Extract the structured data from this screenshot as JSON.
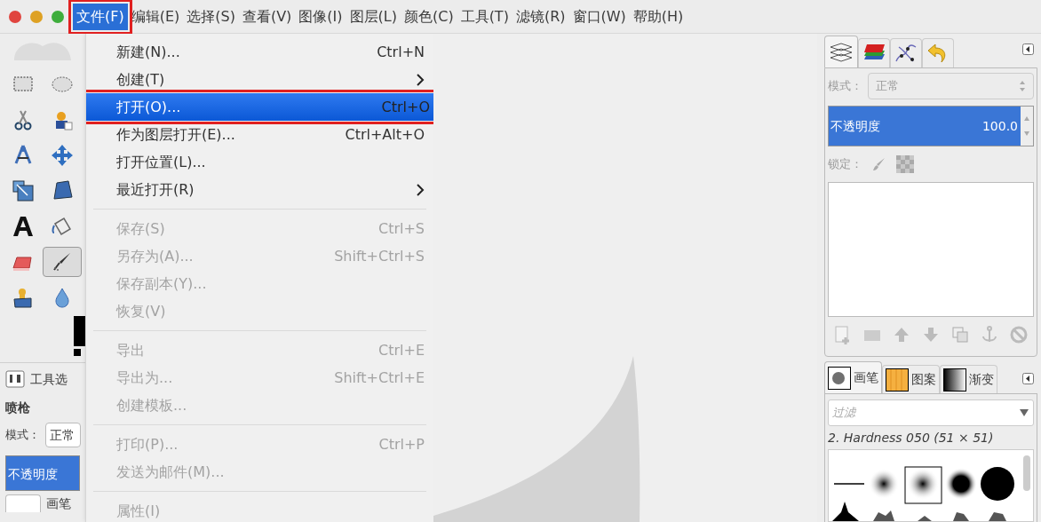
{
  "window_controls": [
    {
      "color": "#e0443e"
    },
    {
      "color": "#dea123"
    },
    {
      "color": "#3ead3c"
    }
  ],
  "menubar": [
    {
      "label": "文件(F)",
      "selected": true,
      "annotated": true
    },
    {
      "label": "编辑(E)",
      "selected": false,
      "annotated": false
    },
    {
      "label": "选择(S)",
      "selected": false,
      "annotated": false
    },
    {
      "label": "查看(V)",
      "selected": false,
      "annotated": false
    },
    {
      "label": "图像(I)",
      "selected": false,
      "annotated": false
    },
    {
      "label": "图层(L)",
      "selected": false,
      "annotated": false
    },
    {
      "label": "颜色(C)",
      "selected": false,
      "annotated": false
    },
    {
      "label": "工具(T)",
      "selected": false,
      "annotated": false
    },
    {
      "label": "滤镜(R)",
      "selected": false,
      "annotated": false
    },
    {
      "label": "窗口(W)",
      "selected": false,
      "annotated": false
    },
    {
      "label": "帮助(H)",
      "selected": false,
      "annotated": false
    }
  ],
  "file_menu": [
    {
      "kind": "item",
      "label": "新建(N)...",
      "shortcut": "Ctrl+N",
      "disabled": false,
      "selected": false,
      "submenu": false,
      "annotated": false
    },
    {
      "kind": "item",
      "label": "创建(T)",
      "disabled": false,
      "selected": false,
      "submenu": true,
      "annotated": false
    },
    {
      "kind": "item",
      "label": "打开(O)...",
      "shortcut": "Ctrl+O",
      "disabled": false,
      "selected": true,
      "submenu": false,
      "annotated": true
    },
    {
      "kind": "item",
      "label": "作为图层打开(E)...",
      "shortcut": "Ctrl+Alt+O",
      "disabled": false,
      "selected": false,
      "submenu": false,
      "annotated": false
    },
    {
      "kind": "item",
      "label": "打开位置(L)...",
      "disabled": false,
      "selected": false,
      "submenu": false,
      "annotated": false
    },
    {
      "kind": "item",
      "label": "最近打开(R)",
      "disabled": false,
      "selected": false,
      "submenu": true,
      "annotated": false
    },
    {
      "kind": "separator"
    },
    {
      "kind": "item",
      "label": "保存(S)",
      "shortcut": "Ctrl+S",
      "disabled": true,
      "selected": false,
      "submenu": false,
      "annotated": false
    },
    {
      "kind": "item",
      "label": "另存为(A)...",
      "shortcut": "Shift+Ctrl+S",
      "disabled": true,
      "selected": false,
      "submenu": false,
      "annotated": false
    },
    {
      "kind": "item",
      "label": "保存副本(Y)...",
      "disabled": true,
      "selected": false,
      "submenu": false,
      "annotated": false
    },
    {
      "kind": "item",
      "label": "恢复(V)",
      "disabled": true,
      "selected": false,
      "submenu": false,
      "annotated": false
    },
    {
      "kind": "separator"
    },
    {
      "kind": "item",
      "label": "导出",
      "shortcut": "Ctrl+E",
      "disabled": true,
      "selected": false,
      "submenu": false,
      "annotated": false
    },
    {
      "kind": "item",
      "label": "导出为...",
      "shortcut": "Shift+Ctrl+E",
      "disabled": true,
      "selected": false,
      "submenu": false,
      "annotated": false
    },
    {
      "kind": "item",
      "label": "创建模板...",
      "disabled": true,
      "selected": false,
      "submenu": false,
      "annotated": false
    },
    {
      "kind": "separator"
    },
    {
      "kind": "item",
      "label": "打印(P)...",
      "shortcut": "Ctrl+P",
      "disabled": true,
      "selected": false,
      "submenu": false,
      "annotated": false
    },
    {
      "kind": "item",
      "label": "发送为邮件(M)...",
      "disabled": true,
      "selected": false,
      "submenu": false,
      "annotated": false
    },
    {
      "kind": "separator"
    },
    {
      "kind": "item",
      "label": "属性(I)",
      "disabled": true,
      "selected": false,
      "submenu": false,
      "annotated": false
    }
  ],
  "tool_options": {
    "title": "工具选",
    "tool_name": "喷枪",
    "mode_label": "模式：",
    "mode_value": "正常",
    "opacity": {
      "label": "不透明度",
      "level": 1
    },
    "brush_label": "画笔"
  },
  "layers_panel": {
    "mode_label": "模式：",
    "mode_value": "正常",
    "opacity": {
      "label": "不透明度",
      "value": "100.0",
      "level": 1
    },
    "lock_label": "锁定："
  },
  "brushes_panel": {
    "tabs": [
      {
        "label": "画笔",
        "selected": true
      },
      {
        "label": "图案",
        "selected": false
      },
      {
        "label": "渐变",
        "selected": false
      }
    ],
    "filter_placeholder": "过滤",
    "brush_name": "2. Hardness 050 (51 × 51)"
  }
}
